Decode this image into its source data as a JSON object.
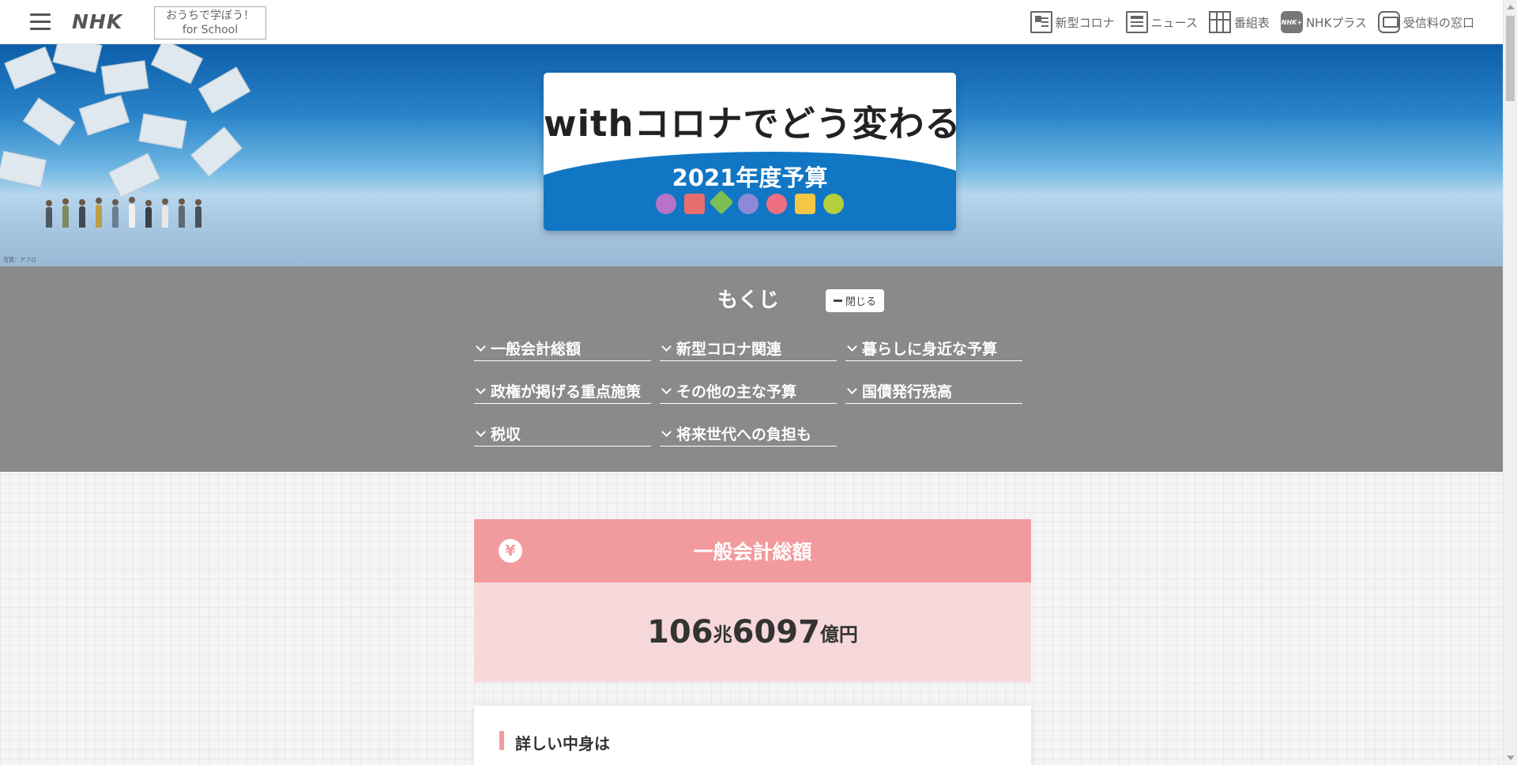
{
  "header": {
    "logo": "NHK",
    "school_line1": "おうちで学ぼう！",
    "school_line2": "for School",
    "nav": [
      {
        "label": "新型コロナ",
        "icon": "corona-icon"
      },
      {
        "label": "ニュース",
        "icon": "news-icon"
      },
      {
        "label": "番組表",
        "icon": "program-guide-icon"
      },
      {
        "label": "NHKプラス",
        "icon": "nhk-plus-icon"
      },
      {
        "label": "受信料の窓口",
        "icon": "reception-fee-icon"
      }
    ]
  },
  "hero": {
    "title": "withコロナでどう変わる",
    "subtitle": "2021年度予算",
    "credit": "写真：アフロ",
    "accent_color": "#1177c4"
  },
  "toc": {
    "title": "もくじ",
    "close_label": "閉じる",
    "links": [
      "一般会計総額",
      "新型コロナ関連",
      "暮らしに身近な予算",
      "政権が掲げる重点施策",
      "その他の主な予算",
      "国債発行残高",
      "税収",
      "将来世代への負担も"
    ]
  },
  "total": {
    "label": "一般会計総額",
    "icon": "yen-icon",
    "value_trillion": "106",
    "unit_trillion": "兆",
    "value_billion": "6097",
    "unit_billion": "億円",
    "accent_color": "#f29b9e"
  },
  "detail": {
    "title": "詳しい中身は"
  }
}
